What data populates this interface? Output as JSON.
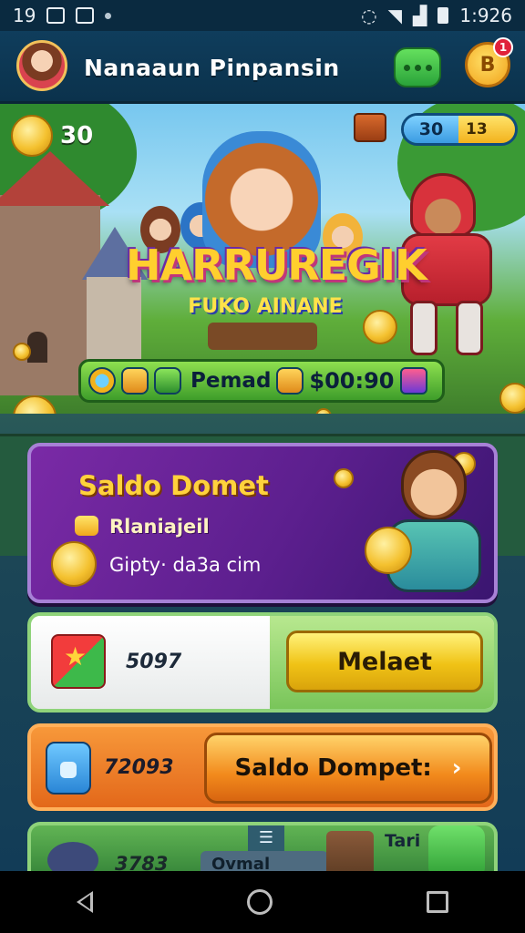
{
  "status_bar": {
    "left_text": "19",
    "time": "1:926",
    "icons": [
      "gallery-icon",
      "app-icon",
      "dot-icon",
      "alarm-icon",
      "wifi-icon",
      "signal-icon",
      "battery-icon"
    ]
  },
  "header": {
    "player_name": "Nanaaun Pinpansin",
    "notification_count": "1",
    "gift_glyph": "B"
  },
  "banner": {
    "coin_count": "30",
    "stat_left": "30",
    "stat_right": "13",
    "logo_title": "HARRUREGIK",
    "logo_subtitle": "FUKO AINANE",
    "reward": {
      "label": "Pemad",
      "amount": "$00:90"
    }
  },
  "wallet_card": {
    "title": "Saldo Domet",
    "subtitle": "Rlaniajeil",
    "description": "Gipty· da3a cim"
  },
  "score_card": {
    "value": "5097",
    "button_label": "Melaet"
  },
  "saldo_card": {
    "value": "72093",
    "button_label": "Saldo Dompet:",
    "arrow": "›"
  },
  "bottom_card": {
    "value": "3783",
    "menu_glyph": "☰",
    "tab_label": "Ovmal",
    "label": "Tari"
  },
  "colors": {
    "header_bg": "#0f3d5c",
    "wallet_purple": "#7a2aa6",
    "button_yellow": "#f0c316",
    "button_orange": "#f28a1c",
    "accent_green": "#3e9d2a"
  }
}
